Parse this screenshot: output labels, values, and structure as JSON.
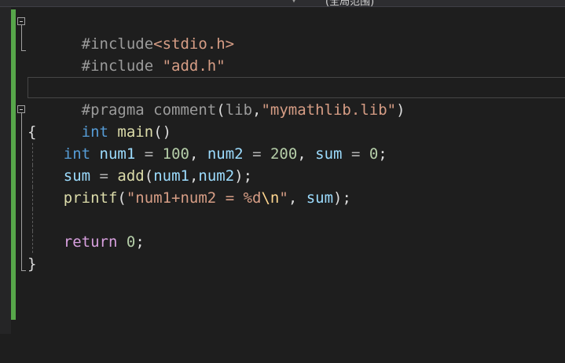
{
  "header": {
    "scope_label": "(全局范围)",
    "dropdown_icon": "chevron-down-icon"
  },
  "colors": {
    "background": "#1e1e1e",
    "change_bar": "#57a64a",
    "preprocessor": "#9b9b9b",
    "include_path": "#d69d85",
    "keyword": "#569cd6",
    "function": "#dcdcaa",
    "variable": "#9cdcfe",
    "number": "#b5cea8",
    "string": "#d69d85",
    "escape": "#ffd68f",
    "control": "#d8a0df"
  },
  "code": {
    "line1": {
      "directive": "#include",
      "path": "<stdio.h>"
    },
    "line2": {
      "directive": "#include",
      "path": "\"add.h\""
    },
    "line4": {
      "directive": "#pragma",
      "word": "comment",
      "open": "(",
      "arg": "lib",
      "comma": ",",
      "str": "\"mymathlib.lib\"",
      "close": ")"
    },
    "line5": {
      "type": "int",
      "name": "main",
      "parens": "()"
    },
    "line6": {
      "brace": "{"
    },
    "line7": {
      "type": "int",
      "v1": "num1",
      "eq1": " = ",
      "n1": "100",
      "c1": ", ",
      "v2": "num2",
      "eq2": " = ",
      "n2": "200",
      "c2": ", ",
      "v3": "sum",
      "eq3": " = ",
      "n3": "0",
      "semi": ";"
    },
    "line8": {
      "v": "sum",
      "eq": " = ",
      "fn": "add",
      "open": "(",
      "a1": "num1",
      "comma": ",",
      "a2": "num2",
      "close": ");"
    },
    "line9": {
      "fn": "printf",
      "open": "(",
      "s1": "\"num1+num2 = ",
      "fmt": "%d",
      "esc": "\\n",
      "s2": "\"",
      "comma": ", ",
      "arg": "sum",
      "close": ");"
    },
    "line11": {
      "kw": "return",
      "num": "0",
      "semi": ";"
    },
    "line12": {
      "brace": "}"
    }
  }
}
